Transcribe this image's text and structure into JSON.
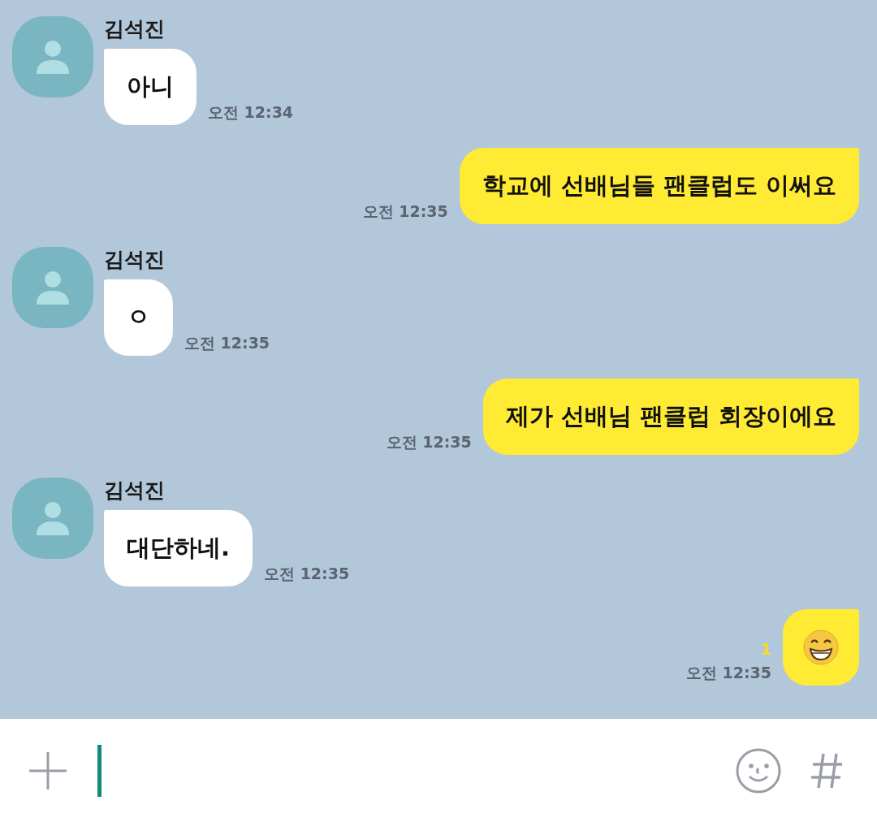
{
  "messages": [
    {
      "kind": "received",
      "sender": "김석진",
      "text": "아니",
      "time": "오전 12:34"
    },
    {
      "kind": "sent",
      "text": "학교에 선배님들 팬클럽도 이써요",
      "time": "오전 12:35"
    },
    {
      "kind": "received",
      "sender": "김석진",
      "text": "ㅇ",
      "time": "오전 12:35"
    },
    {
      "kind": "sent",
      "text": "제가 선배님 팬클럽 회장이에요",
      "time": "오전 12:35"
    },
    {
      "kind": "received",
      "sender": "김석진",
      "text": "대단하네.",
      "time": "오전 12:35"
    },
    {
      "kind": "sent_emoji",
      "unread": "1",
      "time": "오전 12:35"
    }
  ]
}
